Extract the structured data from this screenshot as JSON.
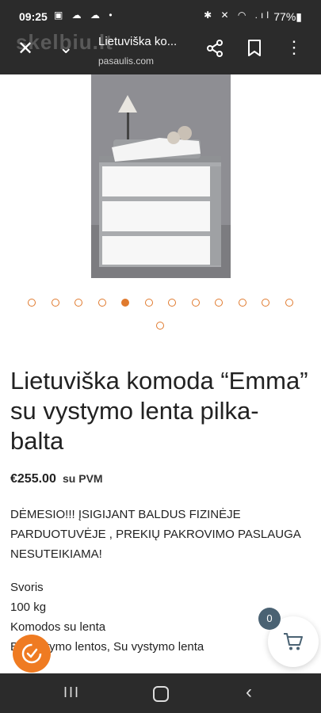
{
  "status_bar": {
    "time": "09:25",
    "left_icons": "▣ ☁ ☁ •",
    "right_icons": "✱ ✕ ◠ .ıl",
    "battery": "77%▮"
  },
  "toolbar": {
    "watermark": "skelbiu.lt",
    "close_glyph": "✕",
    "chevron_glyph": "⌄",
    "title": "Lietuviška ko...",
    "url": "pasaulis.com",
    "more_glyph": "⋮"
  },
  "gallery": {
    "slide_count": 13,
    "active_index": 4
  },
  "product": {
    "title": "Lietuviška komoda “Emma” su vystymo lenta pilka- balta",
    "price": "€255.00",
    "vat": "su PVM",
    "notice": "DĖMESIO!!! ĮSIGIJANT BALDUS FIZINĖJE PARDUOTUVĖJE , PREKIŲ PAKROVIMO PASLAUGA NESUTEIKIAMA!",
    "specs": [
      "Svoris",
      "100 kg",
      "Komodos su lenta",
      "Be vystymo lentos, Su vystymo lenta"
    ]
  },
  "cart": {
    "count": "0"
  },
  "nav": {
    "recents_glyph": "III",
    "back_glyph": "‹"
  },
  "colors": {
    "accent": "#e07a2e",
    "bar": "#2b2b2b",
    "cart_badge": "#4a6273"
  }
}
